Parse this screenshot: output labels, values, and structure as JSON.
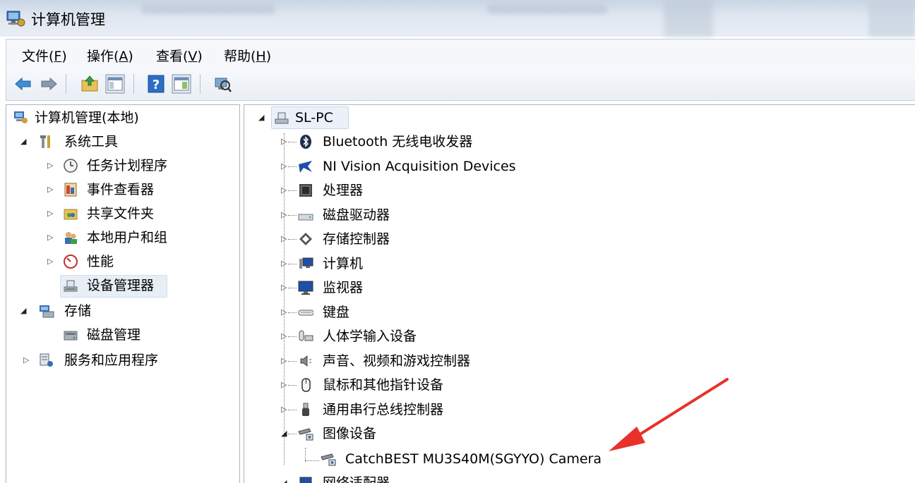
{
  "window": {
    "title": "计算机管理"
  },
  "menu": [
    {
      "label": "文件(",
      "key": "F",
      "tail": ")"
    },
    {
      "label": "操作(",
      "key": "A",
      "tail": ")"
    },
    {
      "label": "查看(",
      "key": "V",
      "tail": ")"
    },
    {
      "label": "帮助(",
      "key": "H",
      "tail": ")"
    }
  ],
  "toolbar": [
    "back-icon",
    "forward-icon",
    "up-folder-icon",
    "show-hide-tree-icon",
    "help-icon",
    "properties-icon",
    "scan-hardware-icon"
  ],
  "left_tree": {
    "root": "计算机管理(本地)",
    "system_tools": "系统工具",
    "task_scheduler": "任务计划程序",
    "event_viewer": "事件查看器",
    "shared_folders": "共享文件夹",
    "local_users": "本地用户和组",
    "performance": "性能",
    "device_manager": "设备管理器",
    "storage": "存储",
    "disk_management": "磁盘管理",
    "services_apps": "服务和应用程序"
  },
  "right_tree": {
    "root": "SL-PC",
    "items": [
      "Bluetooth 无线电收发器",
      "NI Vision Acquisition Devices",
      "处理器",
      "磁盘驱动器",
      "存储控制器",
      "计算机",
      "监视器",
      "键盘",
      "人体学输入设备",
      "声音、视频和游戏控制器",
      "鼠标和其他指针设备",
      "通用串行总线控制器",
      "图像设备"
    ],
    "image_device_child": "CatchBEST MU3S40M(SGYYO) Camera",
    "partial_last": "网络适配器"
  },
  "colors": {
    "arrow": "#e8312a",
    "title_bar": "#dfe7f1",
    "selection": "#e8eef6"
  }
}
